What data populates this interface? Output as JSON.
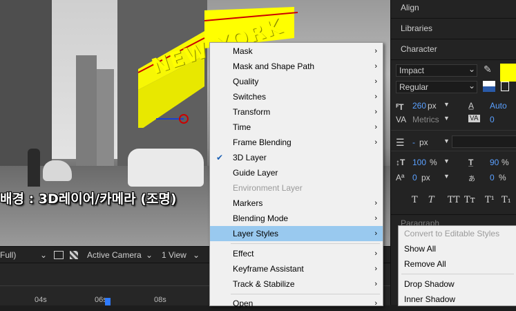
{
  "viewer": {
    "overlay_title": "NEW YORK",
    "caption": "배경 : 3D레이어/카메라 (조명)"
  },
  "viewer_bar": {
    "resolution": "Full)",
    "camera": "Active Camera",
    "views": "1 View"
  },
  "timeline": {
    "labels": [
      "04s",
      "06s",
      "08s"
    ]
  },
  "panels": {
    "align": "Align",
    "libraries": "Libraries",
    "character": "Character",
    "paragraph": "Paragraph"
  },
  "character": {
    "font": "Impact",
    "style": "Regular",
    "size": "260",
    "size_unit": "px",
    "leading": "Auto",
    "kerning": "Metrics",
    "tracking": "0",
    "stroke": "-",
    "stroke_unit": "px",
    "vscale": "100",
    "vscale_unit": "%",
    "hscale": "90",
    "hscale_unit": "%",
    "baseline": "0",
    "baseline_unit": "px",
    "tsume": "0",
    "tsume_unit": "%",
    "style_buttons": [
      "T",
      "T",
      "TT",
      "Tт",
      "T¹",
      "T₁"
    ],
    "fill_color": "#ffff00"
  },
  "context_menu": {
    "items": [
      {
        "label": "Mask",
        "submenu": true
      },
      {
        "label": "Mask and Shape Path",
        "submenu": true
      },
      {
        "label": "Quality",
        "submenu": true
      },
      {
        "label": "Switches",
        "submenu": true
      },
      {
        "label": "Transform",
        "submenu": true
      },
      {
        "label": "Time",
        "submenu": true
      },
      {
        "label": "Frame Blending",
        "submenu": true
      },
      {
        "label": "3D Layer",
        "checked": true
      },
      {
        "label": "Guide Layer"
      },
      {
        "label": "Environment Layer",
        "disabled": true
      },
      {
        "label": "Markers",
        "submenu": true
      },
      {
        "label": "Blending Mode",
        "submenu": true
      },
      {
        "label": "Layer Styles",
        "submenu": true,
        "highlighted": true
      },
      {
        "label": "Effect",
        "submenu": true
      },
      {
        "label": "Keyframe Assistant",
        "submenu": true
      },
      {
        "label": "Track & Stabilize",
        "submenu": true
      },
      {
        "label": "Open",
        "submenu": true
      }
    ]
  },
  "layer_styles_submenu": {
    "items": [
      {
        "label": "Convert to Editable Styles",
        "disabled": true
      },
      {
        "label": "Show All"
      },
      {
        "label": "Remove All"
      },
      {
        "label": "Drop Shadow"
      },
      {
        "label": "Inner Shadow"
      }
    ]
  },
  "colors": {
    "highlight": "#99c9ef",
    "accent_blue": "#5aa0ff",
    "text_fill": "#ffff00"
  }
}
